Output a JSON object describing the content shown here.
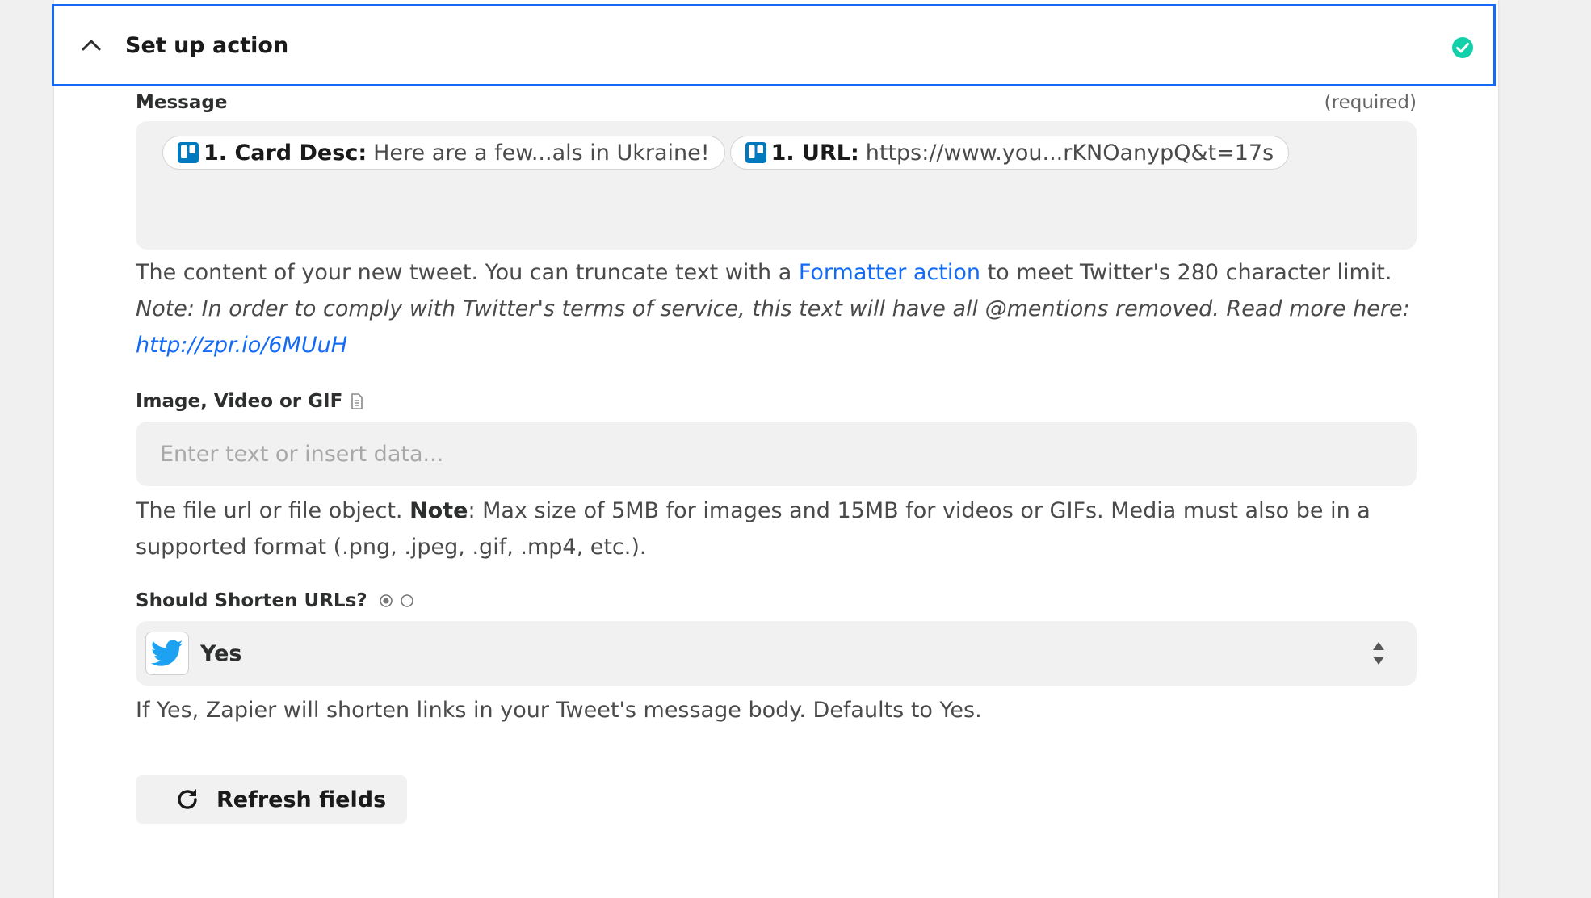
{
  "section": {
    "title": "Set up action",
    "status_icon": "check-circle-icon",
    "status_color": "#13d0ab",
    "accent_color": "#136bf5"
  },
  "message_field": {
    "label": "Message",
    "required_text": "(required)",
    "pills": [
      {
        "icon": "trello-icon",
        "key": "1. Card Desc:",
        "value": "Here are a few...als in Ukraine!"
      },
      {
        "icon": "trello-icon",
        "key": "1. URL:",
        "value": "https://www.you...rKNOanypQ&t=17s"
      }
    ],
    "help": {
      "before_link": "The content of your new tweet. You can truncate text with a ",
      "link_text": "Formatter action",
      "after_link": " to meet Twitter's 280 character limit. ",
      "note_text": "Note: In order to comply with Twitter's terms of service, this text will have all @mentions removed. Read more here: ",
      "note_link": "http://zpr.io/6MUuH"
    }
  },
  "media_field": {
    "label": "Image, Video or GIF",
    "label_icon": "file-icon",
    "placeholder": "Enter text or insert data...",
    "value": "",
    "help_before": "The file url or file object. ",
    "help_bold": "Note",
    "help_after": ": Max size of 5MB for images and 15MB for videos or GIFs. Media must also be in a supported format (.png, .jpeg, .gif, .mp4, etc.)."
  },
  "shorten_field": {
    "label": "Should Shorten URLs?",
    "label_icon": "radio-icon",
    "select_icon": "twitter-icon",
    "selected_value": "Yes",
    "help": "If Yes, Zapier will shorten links in your Tweet's message body. Defaults to Yes."
  },
  "refresh_button": {
    "label": "Refresh fields",
    "icon": "refresh-icon"
  }
}
